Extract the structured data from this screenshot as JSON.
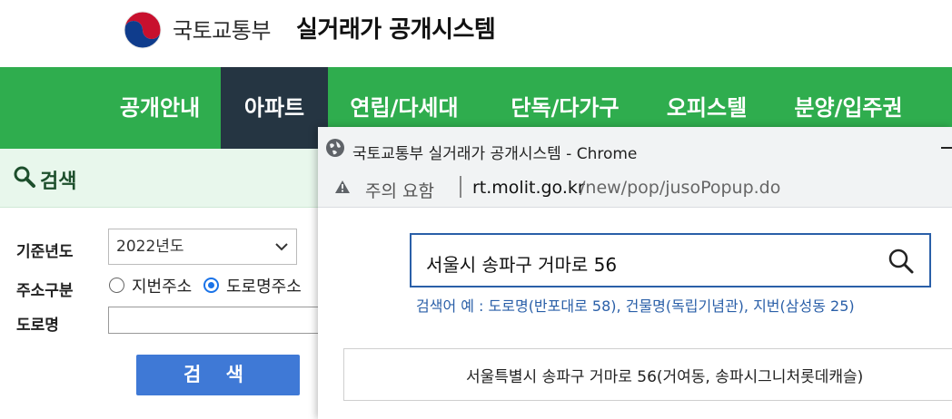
{
  "header": {
    "ministry": "국토교통부",
    "system": "실거래가 공개시스템"
  },
  "nav": {
    "items": [
      "공개안내",
      "아파트",
      "연립/다세대",
      "단독/다가구",
      "오피스텔",
      "분양/입주권"
    ],
    "active": "아파트"
  },
  "search_panel": {
    "title": "검색",
    "year_label": "기준년도",
    "year_value": "2022년도",
    "address_type_label": "주소구분",
    "address_type_options": [
      "지번주소",
      "도로명주소"
    ],
    "address_type_selected": "도로명주소",
    "road_label": "도로명",
    "road_value": "",
    "search_button": "검 색"
  },
  "popup": {
    "window_title": "국토교통부 실거래가 공개시스템 - Chrome",
    "security_warning": "주의 요함",
    "url_host": "rt.molit.go.kr",
    "url_path": "/new/pop/jusoPopup.do",
    "search_value": "서울시 송파구 거마로 56",
    "hint": "검색어 예 : 도로명(반포대로 58), 건물명(독립기념관), 지번(삼성동 25)",
    "result": "서울특별시 송파구 거마로 56(거여동, 송파시그니처롯데캐슬)"
  },
  "colors": {
    "nav_green": "#2fad4e",
    "nav_active": "#253542",
    "button_blue": "#3f79d6",
    "link_blue": "#2a5fa8"
  },
  "icons": [
    "government-emblem-icon",
    "search-icon",
    "chevron-down-icon",
    "globe-icon",
    "warning-icon",
    "magnifier-icon"
  ]
}
